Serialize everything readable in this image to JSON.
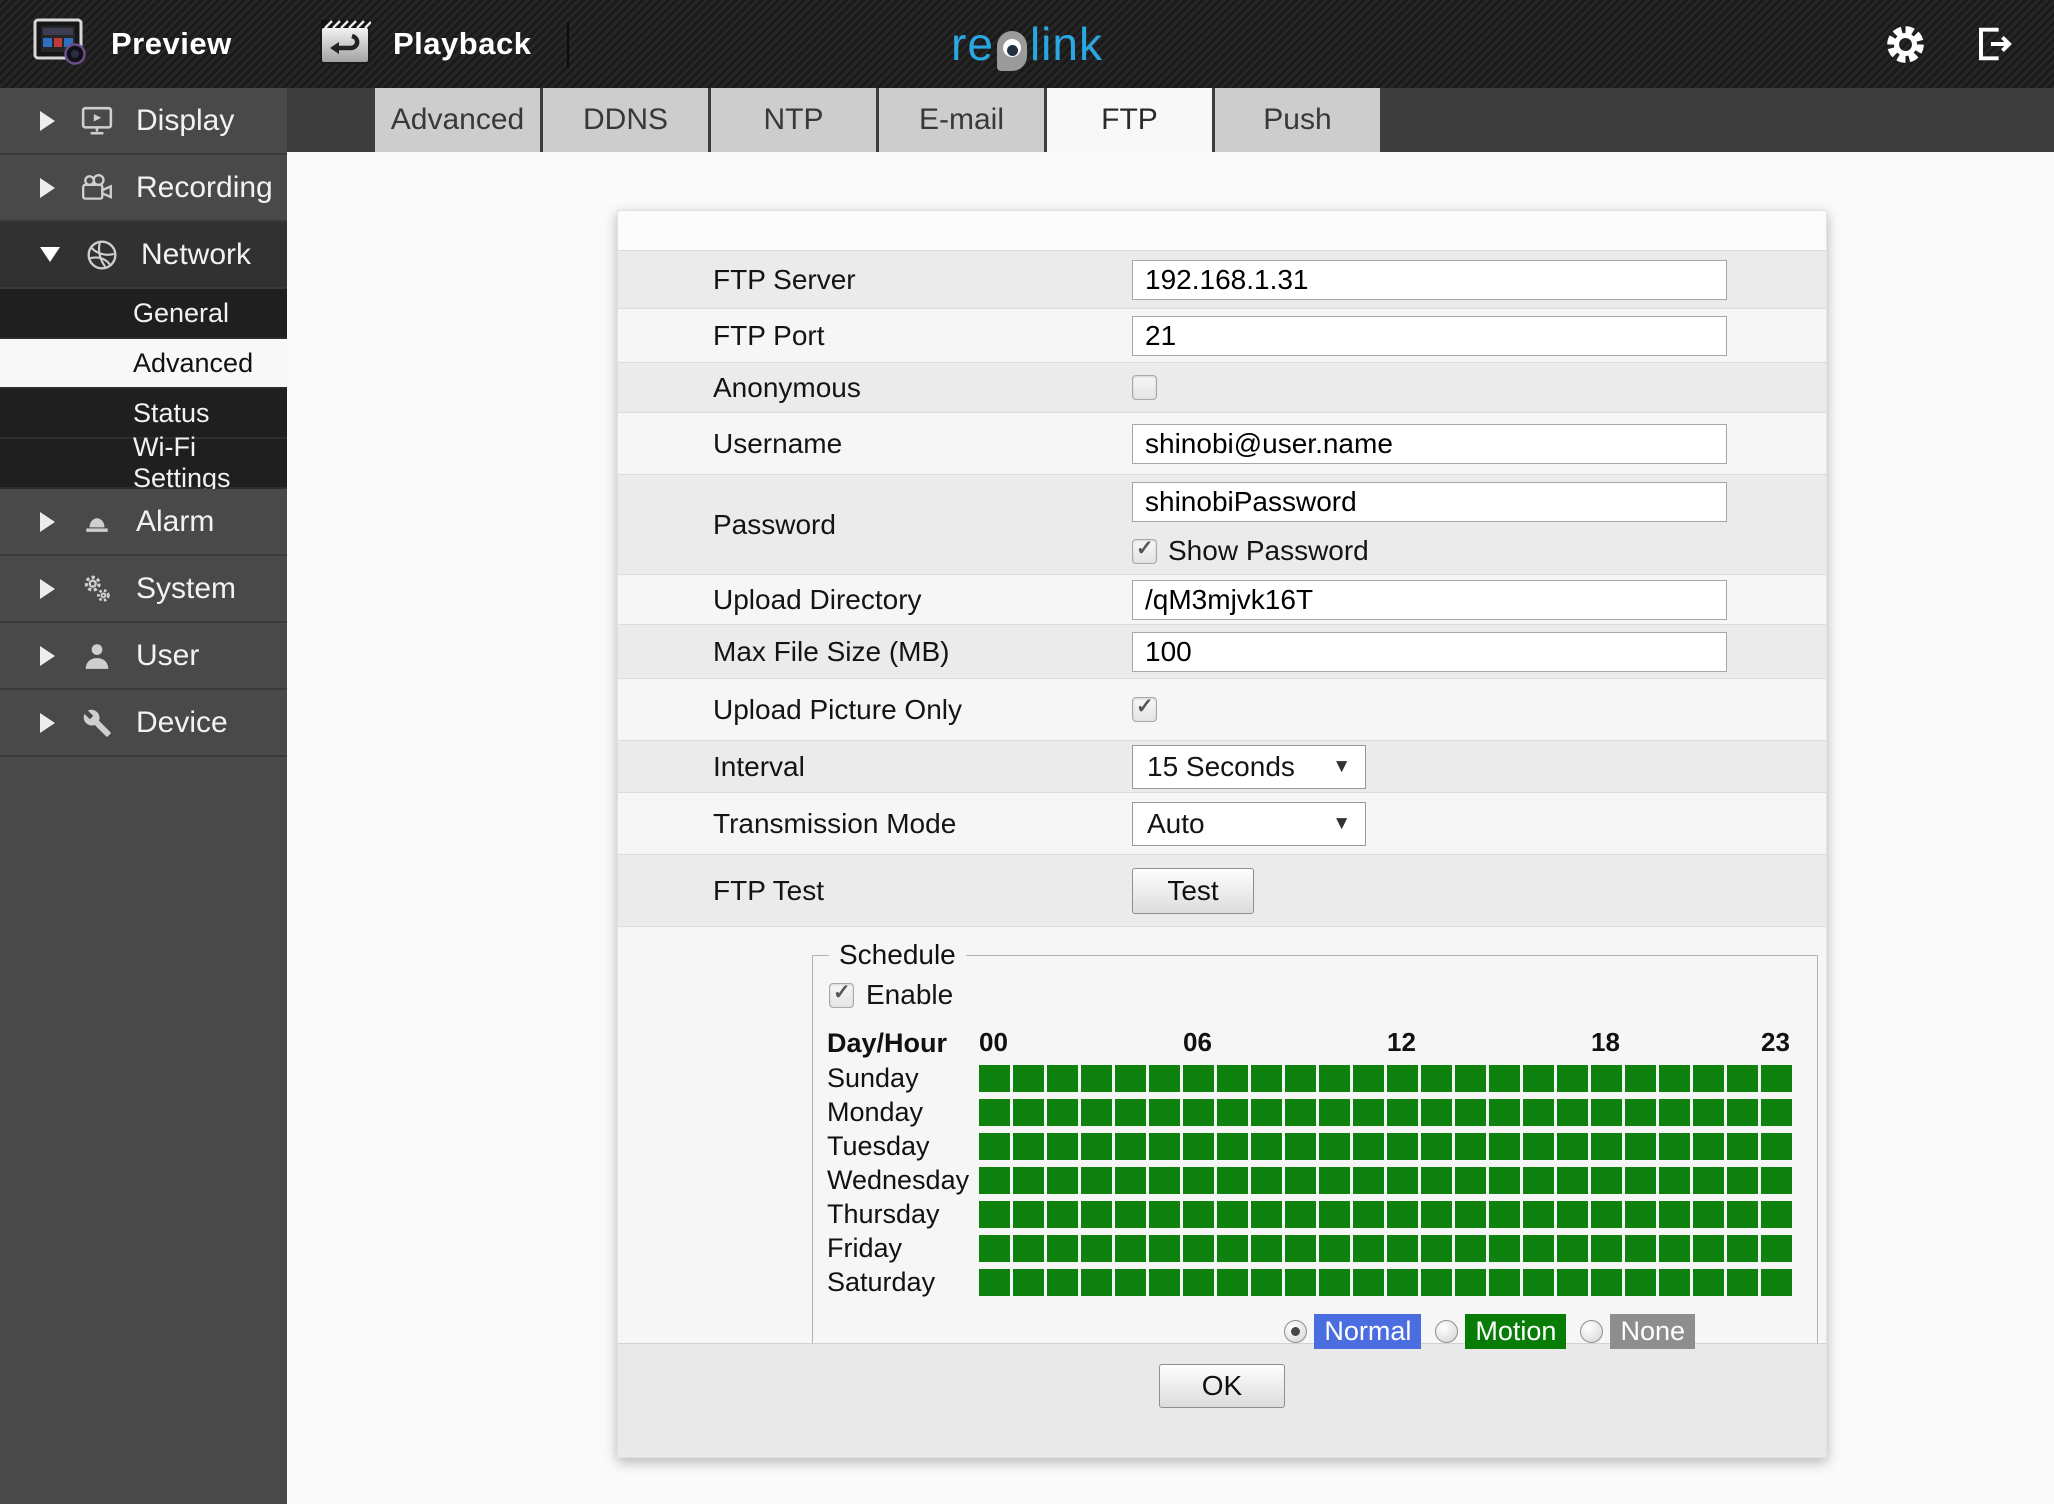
{
  "topbar": {
    "preview_label": "Preview",
    "playback_label": "Playback",
    "brand_part1": "re",
    "brand_part2": "link",
    "brand_color": "#2aa7e0",
    "icons": {
      "preview": "preview-monitor-icon",
      "playback": "playback-clapper-icon",
      "settings": "gear-icon",
      "logout": "logout-icon"
    }
  },
  "sidebar": {
    "items": [
      {
        "label": "Display",
        "icon": "display-monitor-icon",
        "expanded": false
      },
      {
        "label": "Recording",
        "icon": "recording-camera-icon",
        "expanded": false
      },
      {
        "label": "Network",
        "icon": "network-globe-icon",
        "expanded": true
      },
      {
        "label": "Alarm",
        "icon": "alarm-siren-icon",
        "expanded": false
      },
      {
        "label": "System",
        "icon": "system-gears-icon",
        "expanded": false
      },
      {
        "label": "User",
        "icon": "user-person-icon",
        "expanded": false
      },
      {
        "label": "Device",
        "icon": "device-wrench-icon",
        "expanded": false
      }
    ],
    "network_subitems": [
      {
        "label": "General",
        "selected": false
      },
      {
        "label": "Advanced",
        "selected": true
      },
      {
        "label": "Status",
        "selected": false
      },
      {
        "label": "Wi-Fi Settings",
        "selected": false
      }
    ]
  },
  "tabs": [
    {
      "label": "Advanced",
      "active": false
    },
    {
      "label": "DDNS",
      "active": false
    },
    {
      "label": "NTP",
      "active": false
    },
    {
      "label": "E-mail",
      "active": false
    },
    {
      "label": "FTP",
      "active": true
    },
    {
      "label": "Push",
      "active": false
    }
  ],
  "form": {
    "ftp_server": {
      "label": "FTP Server",
      "value": "192.168.1.31"
    },
    "ftp_port": {
      "label": "FTP Port",
      "value": "21"
    },
    "anonymous": {
      "label": "Anonymous",
      "checked": false
    },
    "username": {
      "label": "Username",
      "value": "shinobi@user.name"
    },
    "password": {
      "label": "Password",
      "value": "shinobiPassword",
      "show_password_label": "Show Password",
      "show_password_checked": true
    },
    "upload_directory": {
      "label": "Upload Directory",
      "value": "/qM3mjvk16T"
    },
    "max_file_size": {
      "label": "Max File Size (MB)",
      "value": "100"
    },
    "upload_picture_only": {
      "label": "Upload Picture Only",
      "checked": true
    },
    "interval": {
      "label": "Interval",
      "value": "15 Seconds"
    },
    "transmission_mode": {
      "label": "Transmission Mode",
      "value": "Auto"
    },
    "ftp_test": {
      "label": "FTP Test",
      "button_label": "Test"
    }
  },
  "schedule": {
    "legend": "Schedule",
    "enable_label": "Enable",
    "enable_checked": true,
    "day_hour_label": "Day/Hour",
    "hour_ticks": [
      "00",
      "06",
      "12",
      "18",
      "23"
    ],
    "days": [
      "Sunday",
      "Monday",
      "Tuesday",
      "Wednesday",
      "Thursday",
      "Friday",
      "Saturday"
    ],
    "hours_per_day": 24,
    "all_cells_state": "motion",
    "cell_color": "#0f810f",
    "modes": [
      {
        "label": "Normal",
        "color": "#4a6ddf",
        "selected": true
      },
      {
        "label": "Motion",
        "color": "#077d07",
        "selected": false
      },
      {
        "label": "None",
        "color": "#8e8e8e",
        "selected": false
      }
    ]
  },
  "footer": {
    "ok_label": "OK"
  }
}
